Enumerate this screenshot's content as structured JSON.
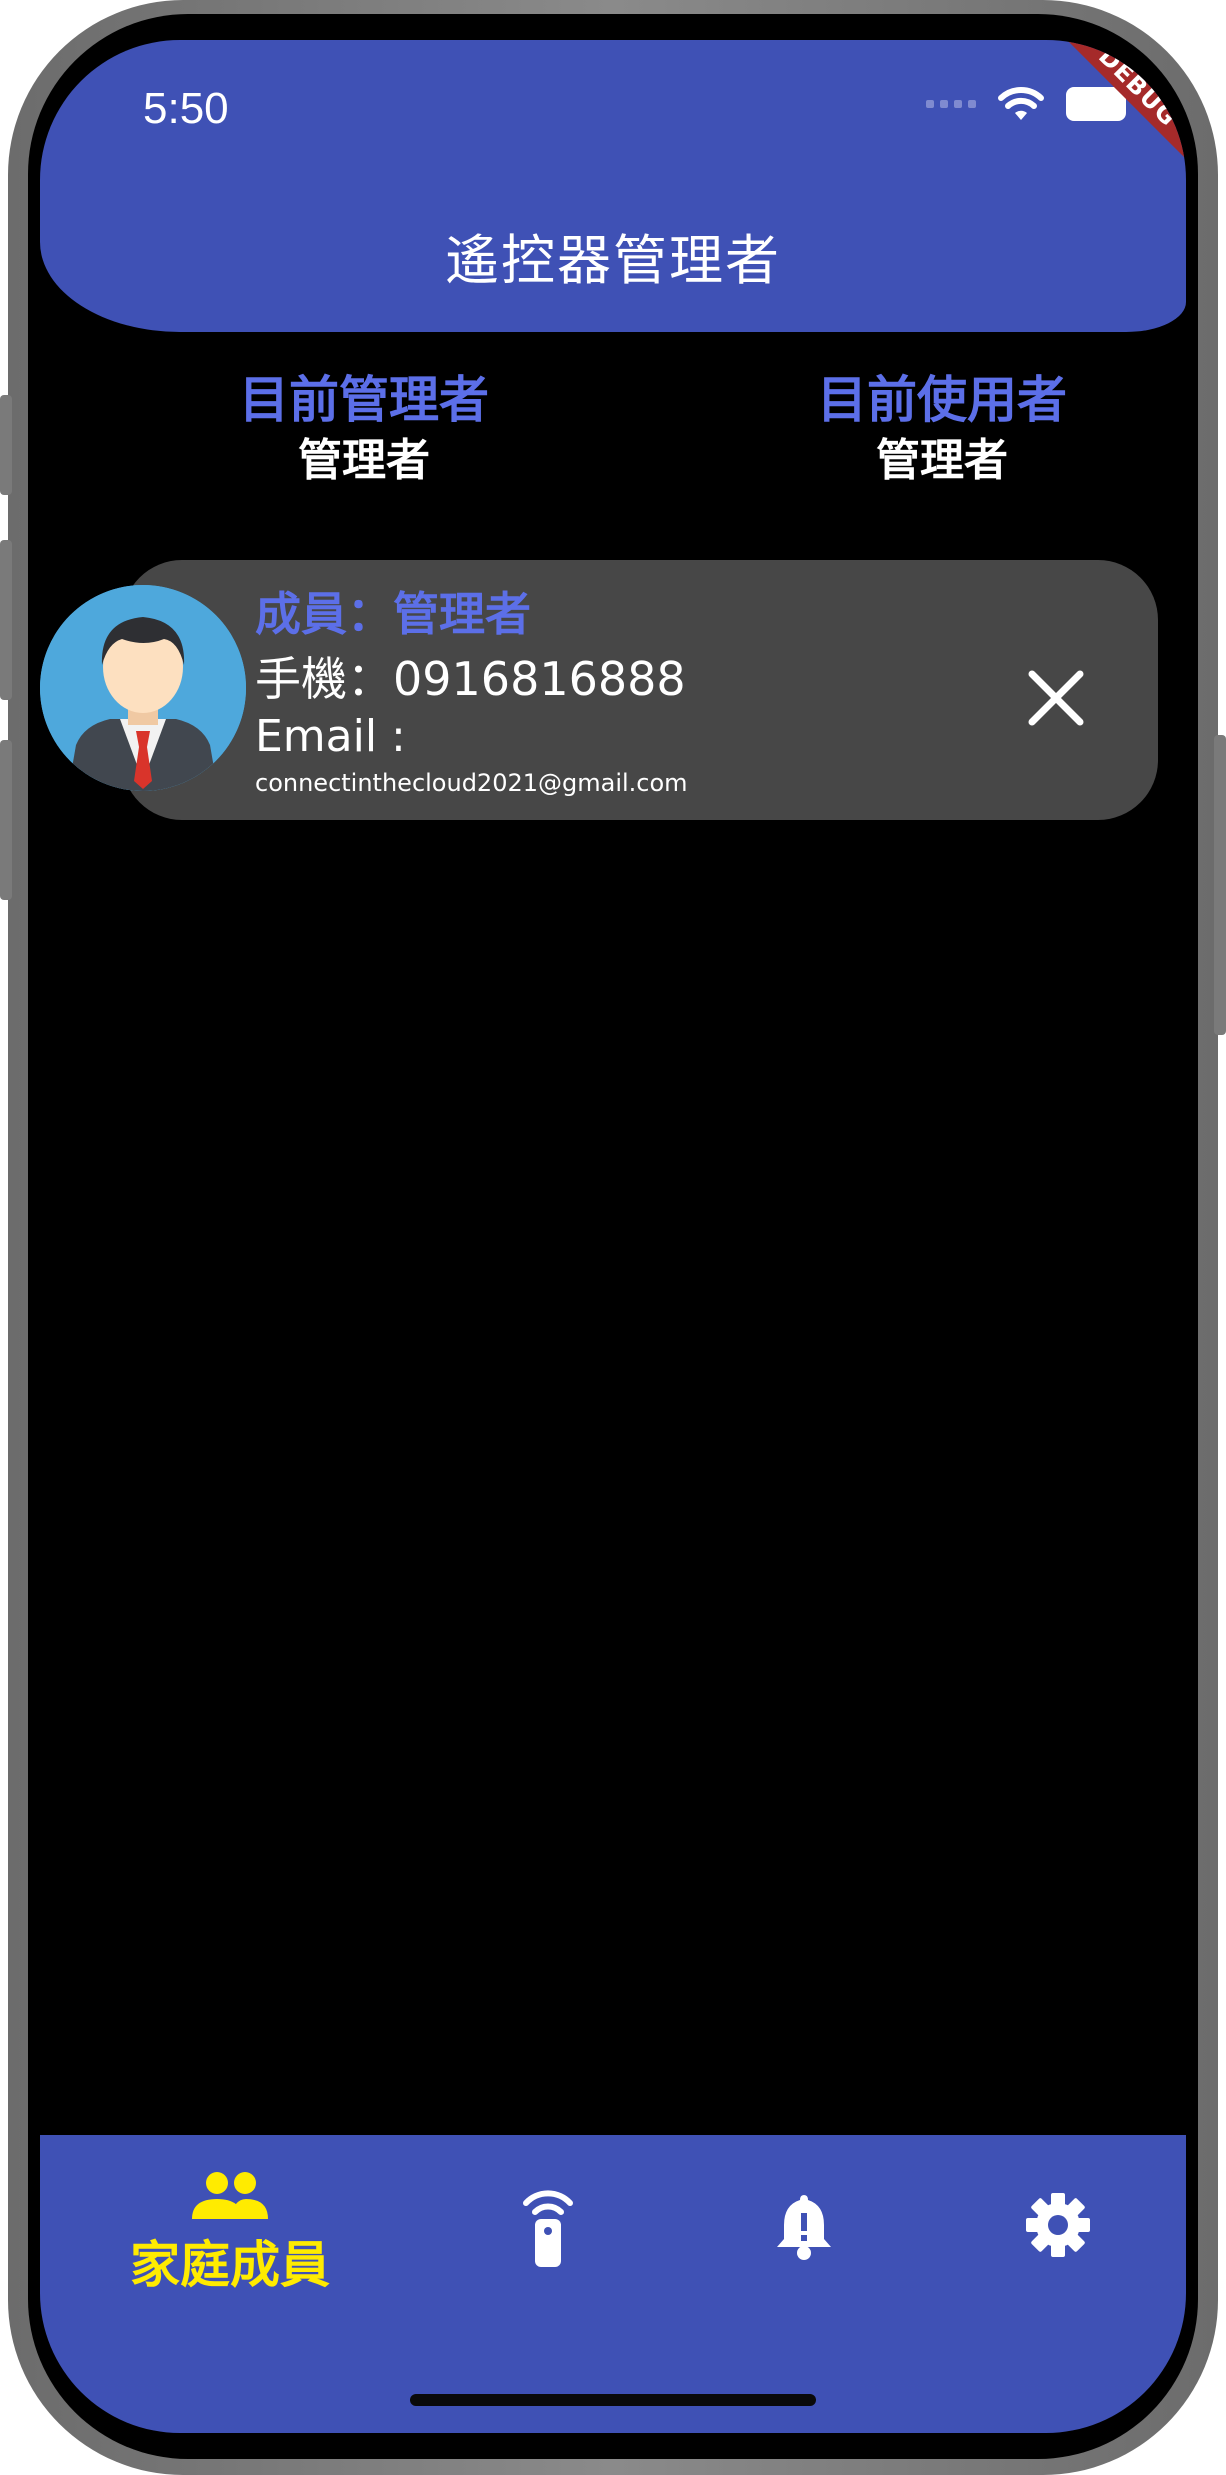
{
  "status_bar": {
    "time": "5:50",
    "debug_label": "DEBUG"
  },
  "header": {
    "title": "遙控器管理者"
  },
  "summary": {
    "manager_label": "目前管理者",
    "manager_value": "管理者",
    "user_label": "目前使用者",
    "user_value": "管理者"
  },
  "members": [
    {
      "role_text": "成員：管理者",
      "phone_text": "手機：0916816888",
      "email_label": "Email :",
      "email": "connectinthecloud2021@gmail.com",
      "avatar_icon": "businessman-avatar-icon",
      "remove_icon": "close-icon"
    }
  ],
  "bottom_nav": {
    "items": [
      {
        "label": "家庭成員",
        "icon": "family-members-icon",
        "active": true
      },
      {
        "label": "",
        "icon": "remote-control-icon",
        "active": false
      },
      {
        "label": "",
        "icon": "bell-icon",
        "active": false
      },
      {
        "label": "",
        "icon": "gear-icon",
        "active": false
      }
    ]
  },
  "colors": {
    "primary": "#3f51b5",
    "accent_text": "#5c6fe8",
    "active_nav": "#ffeb00",
    "card_bg": "#474747",
    "debug_banner": "#a52a2a"
  }
}
